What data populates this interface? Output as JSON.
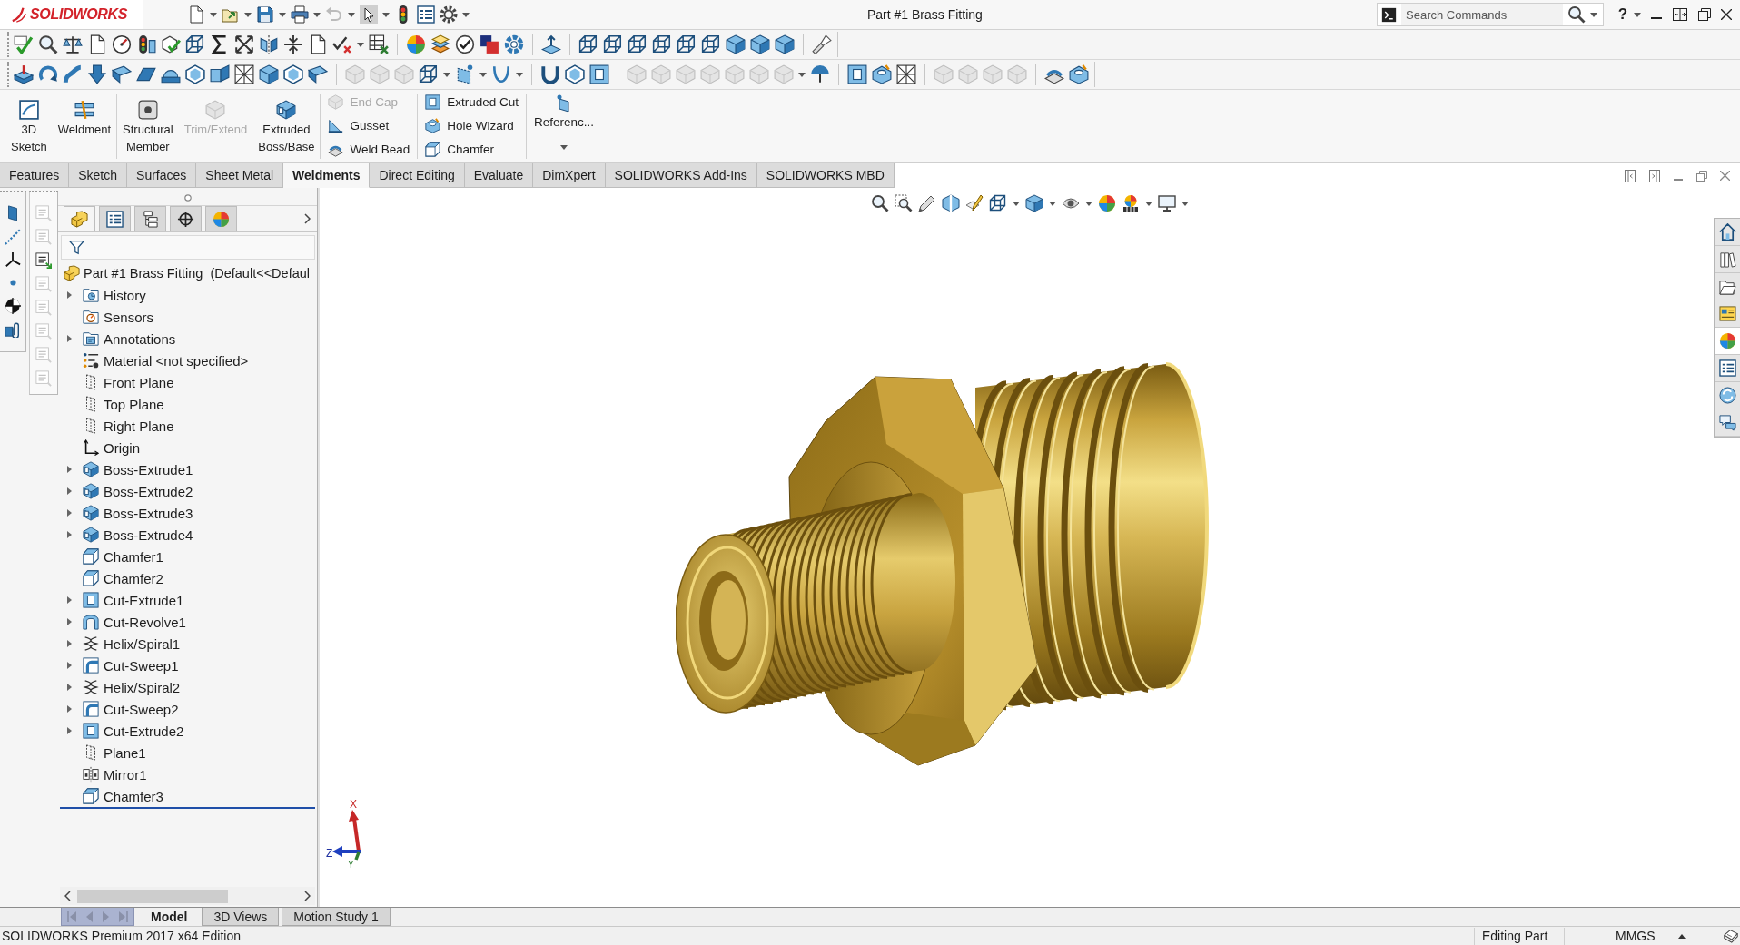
{
  "title_bar": {
    "logo": "SOLIDWORKS",
    "title": "Part #1 Brass Fitting",
    "search": {
      "placeholder": "Search Commands"
    },
    "help": "?"
  },
  "command_manager": {
    "groups": [
      {
        "kind": "large",
        "items": [
          {
            "label": "3D\nSketch",
            "disabled": false
          },
          {
            "label": "Weldment",
            "disabled": false
          }
        ]
      },
      {
        "kind": "large",
        "items": [
          {
            "label": "Structural\nMember",
            "disabled": false
          },
          {
            "label": "Trim/Extend",
            "disabled": true
          },
          {
            "label": "Extruded\nBoss/Base",
            "disabled": false
          }
        ]
      },
      {
        "kind": "stack",
        "items": [
          {
            "label": "End Cap",
            "disabled": true
          },
          {
            "label": "Gusset",
            "disabled": false
          },
          {
            "label": "Weld Bead",
            "disabled": false
          }
        ]
      },
      {
        "kind": "stack",
        "items": [
          {
            "label": "Extruded Cut",
            "disabled": false
          },
          {
            "label": "Hole Wizard",
            "disabled": false
          },
          {
            "label": "Chamfer",
            "disabled": false
          }
        ]
      },
      {
        "kind": "flyout",
        "items": [
          {
            "label": "Referenc...",
            "disabled": false
          }
        ]
      }
    ]
  },
  "tabs": [
    {
      "label": "Features",
      "selected": false
    },
    {
      "label": "Sketch",
      "selected": false
    },
    {
      "label": "Surfaces",
      "selected": false
    },
    {
      "label": "Sheet Metal",
      "selected": false
    },
    {
      "label": "Weldments",
      "selected": true
    },
    {
      "label": "Direct Editing",
      "selected": false
    },
    {
      "label": "Evaluate",
      "selected": false
    },
    {
      "label": "DimXpert",
      "selected": false
    },
    {
      "label": "SOLIDWORKS Add-Ins",
      "selected": false
    },
    {
      "label": "SOLIDWORKS MBD",
      "selected": false
    }
  ],
  "feature_manager": {
    "tabs": [
      {
        "kind": "feature-tree",
        "selected": true
      },
      {
        "kind": "properties",
        "selected": false
      },
      {
        "kind": "configurations",
        "selected": false
      },
      {
        "kind": "dimxpert",
        "selected": false
      },
      {
        "kind": "display",
        "selected": false
      }
    ],
    "tree": {
      "label": "Part #1 Brass Fitting  (Default<<Defaul",
      "kind": "part",
      "children": [
        {
          "label": "History",
          "kind": "history",
          "expandable": true
        },
        {
          "label": "Sensors",
          "kind": "sensors",
          "expandable": false
        },
        {
          "label": "Annotations",
          "kind": "annotations",
          "expandable": true
        },
        {
          "label": "Material <not specified>",
          "kind": "material",
          "expandable": false
        },
        {
          "label": "Front Plane",
          "kind": "plane",
          "expandable": false
        },
        {
          "label": "Top Plane",
          "kind": "plane",
          "expandable": false
        },
        {
          "label": "Right Plane",
          "kind": "plane",
          "expandable": false
        },
        {
          "label": "Origin",
          "kind": "origin",
          "expandable": false
        },
        {
          "label": "Boss-Extrude1",
          "kind": "boss-extrude",
          "expandable": true
        },
        {
          "label": "Boss-Extrude2",
          "kind": "boss-extrude",
          "expandable": true
        },
        {
          "label": "Boss-Extrude3",
          "kind": "boss-extrude",
          "expandable": true
        },
        {
          "label": "Boss-Extrude4",
          "kind": "boss-extrude",
          "expandable": true
        },
        {
          "label": "Chamfer1",
          "kind": "chamfer",
          "expandable": false
        },
        {
          "label": "Chamfer2",
          "kind": "chamfer",
          "expandable": false
        },
        {
          "label": "Cut-Extrude1",
          "kind": "cut-extrude",
          "expandable": true
        },
        {
          "label": "Cut-Revolve1",
          "kind": "cut-revolve",
          "expandable": true
        },
        {
          "label": "Helix/Spiral1",
          "kind": "helix",
          "expandable": true
        },
        {
          "label": "Cut-Sweep1",
          "kind": "cut-sweep",
          "expandable": true
        },
        {
          "label": "Helix/Spiral2",
          "kind": "helix",
          "expandable": true
        },
        {
          "label": "Cut-Sweep2",
          "kind": "cut-sweep",
          "expandable": true
        },
        {
          "label": "Cut-Extrude2",
          "kind": "cut-extrude",
          "expandable": true
        },
        {
          "label": "Plane1",
          "kind": "plane",
          "expandable": false
        },
        {
          "label": "Mirror1",
          "kind": "mirror",
          "expandable": false
        },
        {
          "label": "Chamfer3",
          "kind": "chamfer",
          "expandable": false
        }
      ]
    }
  },
  "graphics": {
    "triad": {
      "x_label": "X",
      "y_label": "Y",
      "z_label": "Z"
    }
  },
  "task_pane": [
    {
      "kind": "home",
      "selected": false
    },
    {
      "kind": "design-library",
      "selected": false
    },
    {
      "kind": "file-explorer",
      "selected": false
    },
    {
      "kind": "view-palette",
      "selected": false
    },
    {
      "kind": "appearances",
      "selected": true
    },
    {
      "kind": "custom-properties",
      "selected": false
    },
    {
      "kind": "resources",
      "selected": false
    },
    {
      "kind": "forum",
      "selected": false
    }
  ],
  "bottom_tabs": [
    {
      "label": "Model",
      "selected": true
    },
    {
      "label": "3D Views",
      "selected": false
    },
    {
      "label": "Motion Study 1",
      "selected": false
    }
  ],
  "status_bar": {
    "edition": "SOLIDWORKS Premium 2017 x64 Edition",
    "mode": "Editing Part",
    "units": "MMGS"
  }
}
